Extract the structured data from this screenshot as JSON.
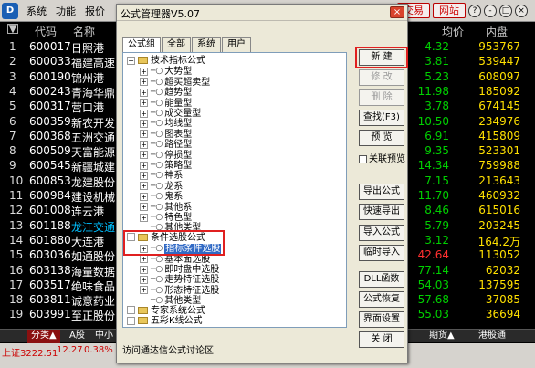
{
  "app": {
    "menu": [
      "系统",
      "功能",
      "报价"
    ],
    "right_pills": [
      "交易",
      "网站"
    ],
    "win_buttons": [
      "?",
      "-",
      "□",
      "×"
    ]
  },
  "list": {
    "columns": {
      "code": "代码",
      "name": "名称",
      "avg": "均价",
      "inner": "内盘"
    },
    "rows": [
      {
        "idx": "1",
        "code": "600017",
        "name": "日照港",
        "avg": "4.32",
        "inner": "953767",
        "avg_color": "#00d000"
      },
      {
        "idx": "2",
        "code": "600033",
        "name": "福建高速",
        "avg": "3.81",
        "inner": "539447",
        "avg_color": "#00d000"
      },
      {
        "idx": "3",
        "code": "600190",
        "name": "锦州港",
        "avg": "5.23",
        "inner": "608097",
        "avg_color": "#00d000"
      },
      {
        "idx": "4",
        "code": "600243",
        "name": "青海华鼎",
        "avg": "11.98",
        "inner": "185092",
        "avg_color": "#00d000"
      },
      {
        "idx": "5",
        "code": "600317",
        "name": "营口港",
        "avg": "3.78",
        "inner": "674145",
        "avg_color": "#00d000"
      },
      {
        "idx": "6",
        "code": "600359",
        "name": "新农开发",
        "avg": "10.50",
        "inner": "234976",
        "avg_color": "#00d000"
      },
      {
        "idx": "7",
        "code": "600368",
        "name": "五洲交通",
        "avg": "6.91",
        "inner": "415809",
        "avg_color": "#00d000"
      },
      {
        "idx": "8",
        "code": "600509",
        "name": "天富能源",
        "avg": "9.35",
        "inner": "523301",
        "avg_color": "#00d000"
      },
      {
        "idx": "9",
        "code": "600545",
        "name": "新疆城建",
        "avg": "14.34",
        "inner": "759988",
        "avg_color": "#00d000"
      },
      {
        "idx": "10",
        "code": "600853",
        "name": "龙建股份",
        "avg": "7.15",
        "inner": "213643",
        "avg_color": "#00d000"
      },
      {
        "idx": "11",
        "code": "600984",
        "name": "建设机械",
        "avg": "11.70",
        "inner": "460932",
        "avg_color": "#00d000"
      },
      {
        "idx": "12",
        "code": "601008",
        "name": "连云港",
        "avg": "8.46",
        "inner": "615016",
        "avg_color": "#00d000"
      },
      {
        "idx": "13",
        "code": "601188",
        "name": "龙江交通",
        "avg": "5.79",
        "inner": "203245",
        "avg_color": "#00d000",
        "name_color": "#00c0ff"
      },
      {
        "idx": "14",
        "code": "601880",
        "name": "大连港",
        "avg": "3.12",
        "inner": "164.2万",
        "avg_color": "#00d000"
      },
      {
        "idx": "15",
        "code": "603036",
        "name": "如通股份",
        "avg": "42.64",
        "inner": "113052",
        "avg_color": "#ff3030"
      },
      {
        "idx": "16",
        "code": "603138",
        "name": "海量数据",
        "avg": "77.14",
        "inner": "62032",
        "avg_color": "#00d000"
      },
      {
        "idx": "17",
        "code": "603517",
        "name": "绝味食品",
        "avg": "54.03",
        "inner": "137595",
        "avg_color": "#00d000"
      },
      {
        "idx": "18",
        "code": "603811",
        "name": "诚意药业",
        "avg": "57.68",
        "inner": "37085",
        "avg_color": "#00d000"
      },
      {
        "idx": "19",
        "code": "603991",
        "name": "至正股份",
        "avg": "55.03",
        "inner": "36694",
        "avg_color": "#00d000"
      }
    ]
  },
  "bottom_tabs": {
    "cat": "分类▲",
    "a": "A股",
    "mid": "中小",
    "fund": "期货▲",
    "hk": "港股通"
  },
  "status": {
    "index": "上证3222.51",
    "change": "12.27",
    "pct": "0.38%"
  },
  "dialog": {
    "title": "公式管理器V5.07",
    "close": "×",
    "tabs": [
      "公式组",
      "全部",
      "系统",
      "用户"
    ],
    "tree": [
      {
        "depth": 0,
        "kind": "folder",
        "exp": "−",
        "label": "技术指标公式"
      },
      {
        "depth": 1,
        "kind": "fx",
        "exp": "+",
        "label": "大势型"
      },
      {
        "depth": 1,
        "kind": "fx",
        "exp": "+",
        "label": "超买超卖型"
      },
      {
        "depth": 1,
        "kind": "fx",
        "exp": "+",
        "label": "趋势型"
      },
      {
        "depth": 1,
        "kind": "fx",
        "exp": "+",
        "label": "能量型"
      },
      {
        "depth": 1,
        "kind": "fx",
        "exp": "+",
        "label": "成交量型"
      },
      {
        "depth": 1,
        "kind": "fx",
        "exp": "+",
        "label": "均线型"
      },
      {
        "depth": 1,
        "kind": "fx",
        "exp": "+",
        "label": "图表型"
      },
      {
        "depth": 1,
        "kind": "fx",
        "exp": "+",
        "label": "路径型"
      },
      {
        "depth": 1,
        "kind": "fx",
        "exp": "+",
        "label": "停损型"
      },
      {
        "depth": 1,
        "kind": "fx",
        "exp": "+",
        "label": "策略型"
      },
      {
        "depth": 1,
        "kind": "fx",
        "exp": "+",
        "label": "神系"
      },
      {
        "depth": 1,
        "kind": "fx",
        "exp": "+",
        "label": "龙系"
      },
      {
        "depth": 1,
        "kind": "fx",
        "exp": "+",
        "label": "鬼系"
      },
      {
        "depth": 1,
        "kind": "fx",
        "exp": "+",
        "label": "其他系"
      },
      {
        "depth": 1,
        "kind": "fx",
        "exp": "+",
        "label": "特色型"
      },
      {
        "depth": 1,
        "kind": "fx",
        "exp": "",
        "label": "其他类型"
      },
      {
        "depth": 0,
        "kind": "folder",
        "exp": "−",
        "label": "条件选股公式"
      },
      {
        "depth": 1,
        "kind": "fx",
        "exp": "+",
        "label": "指标条件选股",
        "selected": true
      },
      {
        "depth": 1,
        "kind": "fx",
        "exp": "+",
        "label": "基本面选股"
      },
      {
        "depth": 1,
        "kind": "fx",
        "exp": "+",
        "label": "即时盘中选股"
      },
      {
        "depth": 1,
        "kind": "fx",
        "exp": "+",
        "label": "走势特征选股"
      },
      {
        "depth": 1,
        "kind": "fx",
        "exp": "+",
        "label": "形态特征选股"
      },
      {
        "depth": 1,
        "kind": "fx",
        "exp": "",
        "label": "其他类型"
      },
      {
        "depth": 0,
        "kind": "folder",
        "exp": "+",
        "label": "专家系统公式"
      },
      {
        "depth": 0,
        "kind": "folder",
        "exp": "+",
        "label": "五彩K线公式"
      }
    ],
    "buttons": {
      "new": "新 建",
      "edit": "修 改",
      "delete": "删 除",
      "find": "查找(F3)",
      "preview": "预 览",
      "export": "导出公式",
      "quick_export": "快速导出",
      "import": "导入公式",
      "temp_import": "临时导入",
      "dll": "DLL函数",
      "restore": "公式恢复",
      "ui_settings": "界面设置",
      "close": "关 闭"
    },
    "checkbox_label": "关联预览",
    "footer": "访问通达信公式讨论区"
  },
  "highlight_color": "#e02020"
}
